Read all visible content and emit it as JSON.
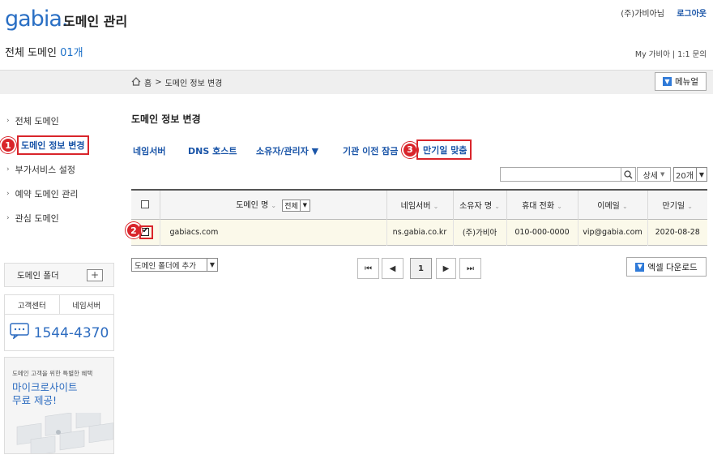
{
  "header": {
    "logo": "gabia.",
    "app_title": "도메인 관리",
    "company": "(주)가비아님",
    "logout": "로그아웃",
    "total_label": "전체 도메인",
    "total_count": "01개",
    "my_links": "My 가비아   |   1:1 문의"
  },
  "breadcrumb": {
    "home": "홈",
    "sep": ">",
    "current": "도메인 정보 변경"
  },
  "menu_button": "메뉴얼",
  "sidebar": {
    "items": [
      {
        "label": "전체 도메인"
      },
      {
        "label": "도메인 정보 변경"
      },
      {
        "label": "부가서비스 설정"
      },
      {
        "label": "예약 도메인 관리"
      },
      {
        "label": "관심 도메인"
      }
    ],
    "folder_label": "도메인 폴더",
    "folder_add": "+",
    "cs_tabs": [
      "고객센터",
      "네임서버"
    ],
    "phone": "1544-4370",
    "promo_small": "도메인 고객을 위한 특별한 혜택",
    "promo_big_1": "마이크로사이트",
    "promo_big_2": "무료 제공!"
  },
  "main": {
    "title": "도메인 정보 변경",
    "tabs": [
      {
        "label": "네임서버"
      },
      {
        "label": "DNS 호스트"
      },
      {
        "label": "소유자/관리자 ▼"
      },
      {
        "label": "기관 이전 잠금"
      },
      {
        "label": "만기일 맞춤"
      }
    ],
    "search_placeholder": "",
    "detail_label": "상세",
    "count_label": "20개",
    "table": {
      "headers": {
        "domain": "도메인 명",
        "filter": "전체",
        "nameserver": "네임서버",
        "owner": "소유자 명",
        "phone": "휴대 전화",
        "email": "이메일",
        "expire": "만기일"
      },
      "rows": [
        {
          "domain": "gabiacs.com",
          "nameserver": "ns.gabia.co.kr",
          "owner": "(주)가비아",
          "phone": "010-000-0000",
          "email": "vip@gabia.com",
          "expire": "2020-08-28"
        }
      ]
    },
    "folder_select": "도메인 폴더에 추가",
    "pager": {
      "first": "⏮",
      "prev": "◀",
      "current": "1",
      "next": "▶",
      "last": "⏭"
    },
    "excel_button": "엑셀 다운로드"
  },
  "annotations": {
    "b1": "1",
    "b2": "2",
    "b3": "3"
  },
  "colors": {
    "accent": "#1a55a8",
    "highlight": "#d9252b",
    "row_bg": "#fbf9ea"
  }
}
